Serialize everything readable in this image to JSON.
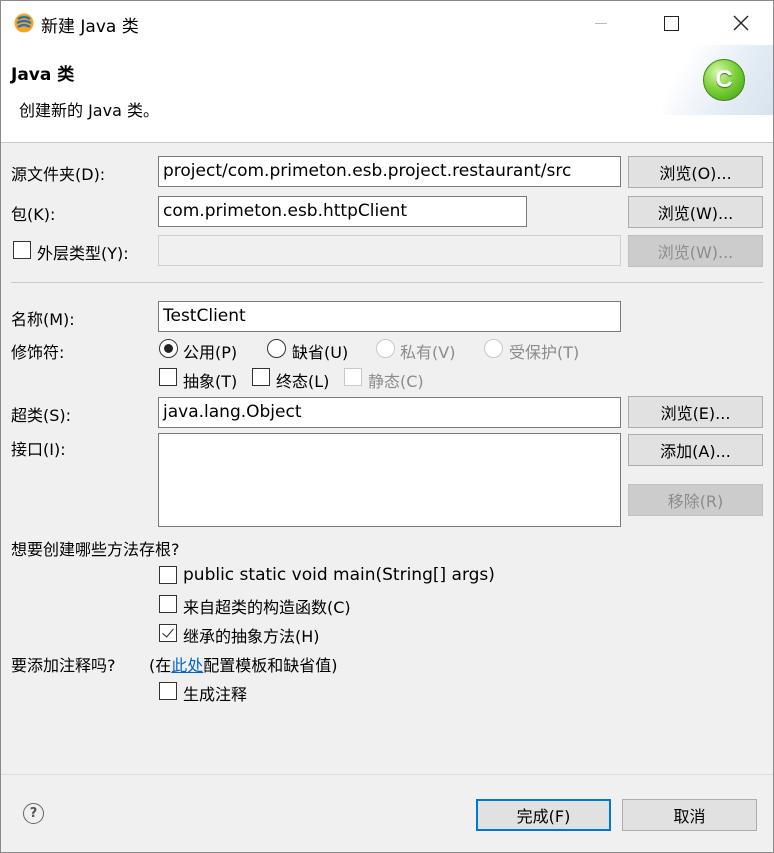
{
  "window": {
    "title": "新建 Java 类"
  },
  "header": {
    "title": "Java 类",
    "description": "创建新的 Java 类。",
    "icon_letter": "C"
  },
  "source_folder": {
    "label": "源文件夹(D):",
    "value": "project/com.primeton.esb.project.restaurant/src",
    "browse_label": "浏览(O)..."
  },
  "package": {
    "label": "包(K):",
    "value": "com.primeton.esb.httpClient",
    "browse_label": "浏览(W)..."
  },
  "enclosing_type": {
    "label": "外层类型(Y):",
    "checked": false,
    "value": "",
    "browse_label": "浏览(W)..."
  },
  "name": {
    "label": "名称(M):",
    "value": "TestClient"
  },
  "modifiers": {
    "label": "修饰符:",
    "access": [
      {
        "label": "公用(P)",
        "checked": true,
        "enabled": true
      },
      {
        "label": "缺省(U)",
        "checked": false,
        "enabled": true
      },
      {
        "label": "私有(V)",
        "checked": false,
        "enabled": false
      },
      {
        "label": "受保护(T)",
        "checked": false,
        "enabled": false
      }
    ],
    "flags": [
      {
        "label": "抽象(T)",
        "checked": false,
        "enabled": true
      },
      {
        "label": "终态(L)",
        "checked": false,
        "enabled": true
      },
      {
        "label": "静态(C)",
        "checked": false,
        "enabled": false
      }
    ]
  },
  "superclass": {
    "label": "超类(S):",
    "value": "java.lang.Object",
    "browse_label": "浏览(E)..."
  },
  "interfaces": {
    "label": "接口(I):",
    "add_label": "添加(A)...",
    "remove_label": "移除(R)"
  },
  "stubs": {
    "question": "想要创建哪些方法存根?",
    "options": [
      {
        "label": "public static void main(String[] args)",
        "checked": false
      },
      {
        "label": "来自超类的构造函数(C)",
        "checked": false
      },
      {
        "label": "继承的抽象方法(H)",
        "checked": true
      }
    ]
  },
  "comments": {
    "question": "要添加注释吗?",
    "hint_prefix": "(在",
    "hint_link": "此处",
    "hint_suffix": "配置模板和缺省值)",
    "generate_label": "生成注释",
    "generate_checked": false
  },
  "footer": {
    "help_symbol": "?",
    "finish_label": "完成(F)",
    "cancel_label": "取消"
  }
}
